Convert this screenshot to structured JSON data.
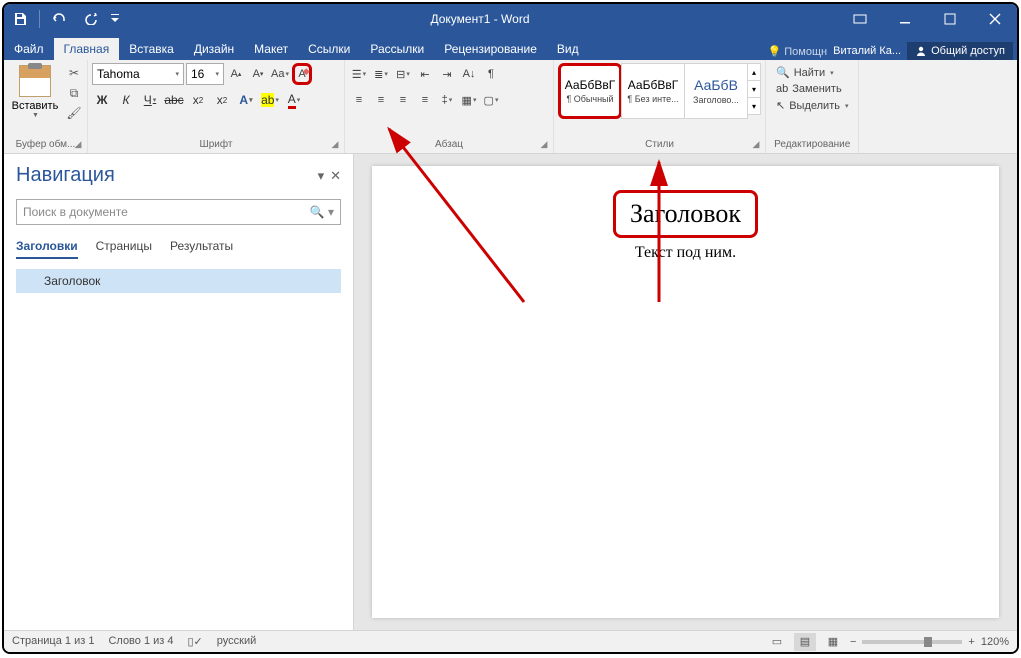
{
  "title": "Документ1 - Word",
  "tabs": [
    "Файл",
    "Главная",
    "Вставка",
    "Дизайн",
    "Макет",
    "Ссылки",
    "Рассылки",
    "Рецензирование",
    "Вид"
  ],
  "tellMe": "Помощн",
  "user": "Виталий Ка...",
  "share": "Общий доступ",
  "ribbon": {
    "clipboard": {
      "label": "Буфер обм...",
      "paste": "Вставить"
    },
    "font": {
      "label": "Шрифт",
      "name": "Tahoma",
      "size": "16"
    },
    "paragraph": {
      "label": "Абзац"
    },
    "styles": {
      "label": "Стили",
      "preview": "АаБбВвГ",
      "preview2": "АаБбВ",
      "items": [
        "¶ Обычный",
        "¶ Без инте...",
        "Заголово..."
      ]
    },
    "editing": {
      "label": "Редактирование",
      "find": "Найти",
      "replace": "Заменить",
      "select": "Выделить"
    }
  },
  "nav": {
    "title": "Навигация",
    "searchPlaceholder": "Поиск в документе",
    "tabs": [
      "Заголовки",
      "Страницы",
      "Результаты"
    ],
    "items": [
      "Заголовок"
    ]
  },
  "document": {
    "heading": "Заголовок",
    "body": "Текст под ним."
  },
  "status": {
    "page": "Страница 1 из 1",
    "words": "Слово 1 из 4",
    "language": "русский",
    "zoom": "120%"
  }
}
